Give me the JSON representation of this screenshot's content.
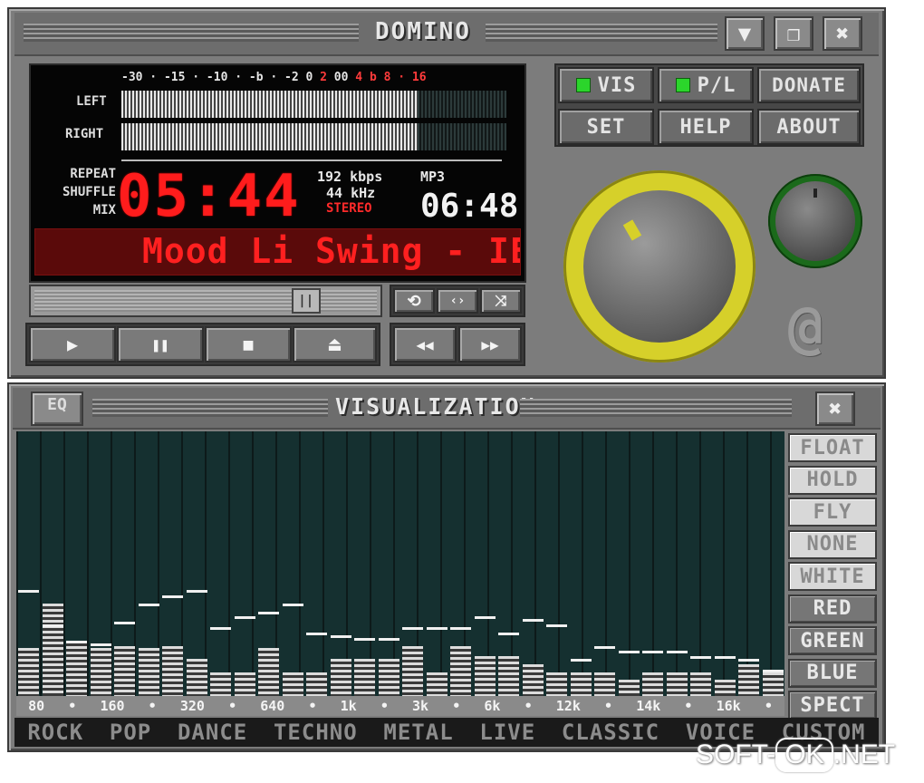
{
  "main": {
    "title": "DOMINO",
    "btn_min": "▼",
    "btn_restore": "❐",
    "btn_close": "✖"
  },
  "display": {
    "scale_white": "-30 · -15 · -10 · -b · -2  0 ",
    "scale_red_2": "2",
    "scale_mid": " 00 ",
    "scale_red": "4 b 8 · 16",
    "left": "LEFT",
    "right": "RIGHT",
    "left_level": 0.77,
    "right_level": 0.77,
    "repeat": "REPEAT",
    "shuffle": "SHUFFLE",
    "mix": "MIX",
    "time": "05:44",
    "bitrate": "192 kbps",
    "samplerate": "44 kHz",
    "stereo": "STEREO",
    "format": "MP3",
    "total": "06:48",
    "song": "Mood Li Swing - IE"
  },
  "controls": {
    "seek_pos": 0.82,
    "seek_knob": "||",
    "repeat_icon": "⟲",
    "crossfade_icon": "‹›",
    "shuffle_icon": "⤨",
    "play": "▶",
    "pause": "❚❚",
    "stop": "■",
    "eject": "⏏",
    "prev": "◀◀",
    "next": "▶▶"
  },
  "side": {
    "vis": "VIS",
    "pl": "P/L",
    "donate": "DONATE",
    "set": "SET",
    "help": "HELP",
    "about": "ABOUT",
    "logo": "@"
  },
  "viz": {
    "title": "VISUALIZATION",
    "eq": "EQ",
    "close": "✖",
    "options": [
      "FLOAT",
      "HOLD",
      "FLY",
      "NONE",
      "WHITE",
      "RED",
      "GREEN",
      "BLUE",
      "SPECT"
    ],
    "freq": [
      "80",
      "•",
      "160",
      "•",
      "320",
      "•",
      "640",
      "•",
      "1k",
      "•",
      "3k",
      "•",
      "6k",
      "•",
      "12k",
      "•",
      "14k",
      "•",
      "16k",
      "•"
    ],
    "presets": [
      "ROCK",
      "POP",
      "DANCE",
      "TECHNO",
      "METAL",
      "LIVE",
      "CLASSIC",
      "VOICE",
      "CUSTOM"
    ],
    "bars": [
      0.18,
      0.35,
      0.21,
      0.18,
      0.19,
      0.18,
      0.19,
      0.14,
      0.09,
      0.09,
      0.18,
      0.09,
      0.09,
      0.14,
      0.14,
      0.14,
      0.19,
      0.09,
      0.19,
      0.15,
      0.15,
      0.12,
      0.09,
      0.09,
      0.09,
      0.06,
      0.09,
      0.09,
      0.09,
      0.06,
      0.12,
      0.09
    ],
    "peaks": [
      0.4,
      0.27,
      0.21,
      0.2,
      0.28,
      0.35,
      0.38,
      0.4,
      0.26,
      0.3,
      0.32,
      0.35,
      0.24,
      0.23,
      0.22,
      0.22,
      0.26,
      0.26,
      0.26,
      0.3,
      0.24,
      0.29,
      0.27,
      0.14,
      0.19,
      0.17,
      0.17,
      0.17,
      0.15,
      0.15,
      0.14,
      0.1
    ]
  },
  "watermark": {
    "a": "SOFT-",
    "b": "OK",
    "c": ".NET"
  }
}
